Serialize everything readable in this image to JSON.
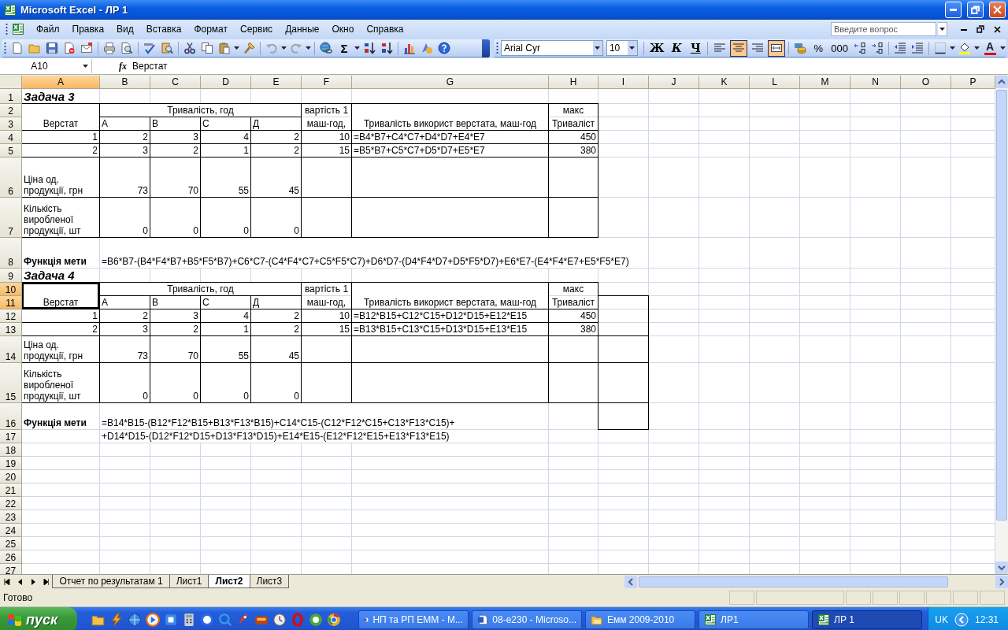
{
  "window": {
    "title": "Microsoft Excel - ЛР 1"
  },
  "menu": [
    "Файл",
    "Правка",
    "Вид",
    "Вставка",
    "Формат",
    "Сервис",
    "Данные",
    "Окно",
    "Справка"
  ],
  "help_search": {
    "placeholder": "Введите вопрос"
  },
  "standard_toolbar": {
    "autosum": "Σ"
  },
  "formatting_toolbar": {
    "font": "Arial Cyr",
    "size": "10",
    "style_buttons": [
      {
        "label": "Ж",
        "selected": false
      },
      {
        "label": "К",
        "selected": false
      },
      {
        "label": "Ч",
        "selected": false
      }
    ],
    "align_buttons": [
      {
        "kind": "left",
        "selected": false
      },
      {
        "kind": "center",
        "selected": true
      },
      {
        "kind": "right",
        "selected": false
      },
      {
        "kind": "merge",
        "selected": true
      }
    ],
    "number_buttons": [
      {
        "kind": "currency"
      },
      {
        "kind": "text",
        "label": "%"
      },
      {
        "kind": "text",
        "label": "000"
      },
      {
        "kind": "increase-decimal"
      },
      {
        "kind": "decrease-decimal"
      }
    ],
    "font_color_label": "A"
  },
  "formula_bar": {
    "name_box": "A10",
    "function_label": "fx",
    "value": "Верстат"
  },
  "columns": [
    {
      "label": "A",
      "selected": true
    },
    {
      "label": "B",
      "selected": false
    },
    {
      "label": "C",
      "selected": false
    },
    {
      "label": "D",
      "selected": false
    },
    {
      "label": "E",
      "selected": false
    },
    {
      "label": "F",
      "selected": false
    },
    {
      "label": "G",
      "selected": false
    },
    {
      "label": "H",
      "selected": false
    },
    {
      "label": "I",
      "selected": false
    },
    {
      "label": "J",
      "selected": false
    },
    {
      "label": "K",
      "selected": false
    },
    {
      "label": "L",
      "selected": false
    },
    {
      "label": "M",
      "selected": false
    },
    {
      "label": "N",
      "selected": false
    },
    {
      "label": "O",
      "selected": false
    },
    {
      "label": "P",
      "selected": false
    }
  ],
  "rows": [
    {
      "number": "1",
      "selected": false,
      "cells": [
        {
          "kind": "title",
          "text": "Задача 3",
          "selected": false
        }
      ]
    },
    {
      "number": "2",
      "selected": false,
      "cells": [
        {
          "kind": "heading",
          "text": "Верстат",
          "selected": false
        },
        {
          "kind": "heading",
          "text": "Тривалість, год",
          "selected": false
        },
        {
          "kind": "covered"
        },
        {
          "kind": "covered"
        },
        {
          "kind": "covered"
        },
        {
          "kind": "heading",
          "text": "вартість 1",
          "selected": false
        },
        {
          "kind": "heading",
          "text": "Тривалість використ верстата, маш-год",
          "selected": false
        },
        {
          "kind": "heading",
          "text": "макс",
          "selected": false
        }
      ]
    },
    {
      "number": "3",
      "selected": false,
      "cells": [
        {
          "kind": "covered_above"
        },
        {
          "kind": "label",
          "text": "А",
          "selected": false
        },
        {
          "kind": "label",
          "text": "В",
          "selected": false
        },
        {
          "kind": "label",
          "text": "С",
          "selected": false
        },
        {
          "kind": "label",
          "text": "Д",
          "selected": false
        },
        {
          "kind": "heading",
          "text": "маш-год,",
          "selected": false
        },
        {
          "kind": "covered_above"
        },
        {
          "kind": "heading",
          "text": "Тривалiст",
          "selected": false
        }
      ]
    },
    {
      "number": "4",
      "selected": false,
      "cells": [
        {
          "kind": "number",
          "text": "1",
          "selected": false
        },
        {
          "kind": "number",
          "text": "2",
          "selected": false
        },
        {
          "kind": "number",
          "text": "3",
          "selected": false
        },
        {
          "kind": "number",
          "text": "4",
          "selected": false
        },
        {
          "kind": "number",
          "text": "2",
          "selected": false
        },
        {
          "kind": "number",
          "text": "10",
          "selected": false
        },
        {
          "kind": "formula",
          "text": "=B4*B7+C4*C7+D4*D7+E4*E7",
          "selected": false
        },
        {
          "kind": "number",
          "text": "450",
          "selected": false
        }
      ]
    },
    {
      "number": "5",
      "selected": false,
      "cells": [
        {
          "kind": "number",
          "text": "2",
          "selected": false
        },
        {
          "kind": "number",
          "text": "3",
          "selected": false
        },
        {
          "kind": "number",
          "text": "2",
          "selected": false
        },
        {
          "kind": "number",
          "text": "1",
          "selected": false
        },
        {
          "kind": "number",
          "text": "2",
          "selected": false
        },
        {
          "kind": "number",
          "text": "15",
          "selected": false
        },
        {
          "kind": "formula",
          "text": "=B5*B7+C5*C7+D5*D7+E5*E7",
          "selected": false
        },
        {
          "kind": "number",
          "text": "380",
          "selected": false
        }
      ]
    },
    {
      "number": "6",
      "selected": false,
      "cells": [
        {
          "kind": "label",
          "text": "Ціна од. продукції, грн",
          "selected": false
        },
        {
          "kind": "number",
          "text": "73",
          "selected": false
        },
        {
          "kind": "number",
          "text": "70",
          "selected": false
        },
        {
          "kind": "number",
          "text": "55",
          "selected": false
        },
        {
          "kind": "number",
          "text": "45",
          "selected": false
        }
      ]
    },
    {
      "number": "7",
      "selected": false,
      "cells": [
        {
          "kind": "label",
          "text": "Кількість виробленої продукції, шт",
          "selected": false
        },
        {
          "kind": "number",
          "text": "0",
          "selected": false
        },
        {
          "kind": "number",
          "text": "0",
          "selected": false
        },
        {
          "kind": "number",
          "text": "0",
          "selected": false
        },
        {
          "kind": "number",
          "text": "0",
          "selected": false
        }
      ]
    },
    {
      "number": "8",
      "selected": false,
      "cells": [
        {
          "kind": "bold",
          "text": "Функція мети",
          "selected": false
        },
        {
          "kind": "formula",
          "text": "=B6*B7-(B4*F4*B7+B5*F5*B7)+C6*C7-(C4*F4*C7+C5*F5*C7)+D6*D7-(D4*F4*D7+D5*F5*D7)+E6*E7-(E4*F4*E7+E5*F5*E7)",
          "selected": false
        }
      ]
    },
    {
      "number": "9",
      "selected": false,
      "cells": [
        {
          "kind": "title",
          "text": "Задача 4",
          "selected": false
        }
      ]
    },
    {
      "number": "10",
      "selected": true,
      "cells": [
        {
          "kind": "heading",
          "text": "Верстат",
          "selected": true
        },
        {
          "kind": "heading",
          "text": "Тривалість, год",
          "selected": false
        },
        {
          "kind": "covered"
        },
        {
          "kind": "covered"
        },
        {
          "kind": "covered"
        },
        {
          "kind": "heading",
          "text": "вартість 1",
          "selected": false
        },
        {
          "kind": "heading",
          "text": "Тривалість використ верстата, маш-год",
          "selected": false
        },
        {
          "kind": "heading",
          "text": "макс",
          "selected": false
        }
      ]
    },
    {
      "number": "11",
      "selected": true,
      "cells": [
        {
          "kind": "covered_above"
        },
        {
          "kind": "label",
          "text": "А",
          "selected": false
        },
        {
          "kind": "label",
          "text": "В",
          "selected": false
        },
        {
          "kind": "label",
          "text": "С",
          "selected": false
        },
        {
          "kind": "label",
          "text": "Д",
          "selected": false
        },
        {
          "kind": "heading",
          "text": "маш-год,",
          "selected": false
        },
        {
          "kind": "covered_above"
        },
        {
          "kind": "heading",
          "text": "Тривалiст",
          "selected": false
        }
      ]
    },
    {
      "number": "12",
      "selected": false,
      "cells": [
        {
          "kind": "number",
          "text": "1",
          "selected": false
        },
        {
          "kind": "number",
          "text": "2",
          "selected": false
        },
        {
          "kind": "number",
          "text": "3",
          "selected": false
        },
        {
          "kind": "number",
          "text": "4",
          "selected": false
        },
        {
          "kind": "number",
          "text": "2",
          "selected": false
        },
        {
          "kind": "number",
          "text": "10",
          "selected": false
        },
        {
          "kind": "formula",
          "text": "=B12*B15+C12*C15+D12*D15+E12*E15",
          "selected": false
        },
        {
          "kind": "number",
          "text": "450",
          "selected": false
        }
      ]
    },
    {
      "number": "13",
      "selected": false,
      "cells": [
        {
          "kind": "number",
          "text": "2",
          "selected": false
        },
        {
          "kind": "number",
          "text": "3",
          "selected": false
        },
        {
          "kind": "number",
          "text": "2",
          "selected": false
        },
        {
          "kind": "number",
          "text": "1",
          "selected": false
        },
        {
          "kind": "number",
          "text": "2",
          "selected": false
        },
        {
          "kind": "number",
          "text": "15",
          "selected": false
        },
        {
          "kind": "formula",
          "text": "=B13*B15+C13*C15+D13*D15+E13*E15",
          "selected": false
        },
        {
          "kind": "number",
          "text": "380",
          "selected": false
        }
      ]
    },
    {
      "number": "14",
      "selected": false,
      "cells": [
        {
          "kind": "label",
          "text": "Ціна од. продукції, грн",
          "selected": false
        },
        {
          "kind": "number",
          "text": "73",
          "selected": false
        },
        {
          "kind": "number",
          "text": "70",
          "selected": false
        },
        {
          "kind": "number",
          "text": "55",
          "selected": false
        },
        {
          "kind": "number",
          "text": "45",
          "selected": false
        }
      ]
    },
    {
      "number": "15",
      "selected": false,
      "cells": [
        {
          "kind": "label",
          "text": "Кількість виробленої продукції, шт",
          "selected": false
        },
        {
          "kind": "number",
          "text": "0",
          "selected": false
        },
        {
          "kind": "number",
          "text": "0",
          "selected": false
        },
        {
          "kind": "number",
          "text": "0",
          "selected": false
        },
        {
          "kind": "number",
          "text": "0",
          "selected": false
        }
      ]
    },
    {
      "number": "16",
      "selected": false,
      "cells": [
        {
          "kind": "bold",
          "text": "Функція мети",
          "selected": false
        },
        {
          "kind": "formula",
          "text": "=B14*B15-(B12*F12*B15+B13*F13*B15)+C14*C15-(C12*F12*C15+C13*F13*C15)+",
          "selected": false
        }
      ]
    },
    {
      "number": "17",
      "selected": false,
      "cells": [
        {
          "kind": "empty"
        },
        {
          "kind": "formula",
          "text": "+D14*D15-(D12*F12*D15+D13*F13*D15)+E14*E15-(E12*F12*E15+E13*F13*E15)",
          "selected": false
        }
      ]
    },
    {
      "number": "18",
      "selected": false
    },
    {
      "number": "19",
      "selected": false
    },
    {
      "number": "20",
      "selected": false
    },
    {
      "number": "21",
      "selected": false
    },
    {
      "number": "22",
      "selected": false
    },
    {
      "number": "23",
      "selected": false
    },
    {
      "number": "24",
      "selected": false
    },
    {
      "number": "25",
      "selected": false
    },
    {
      "number": "26",
      "selected": false
    },
    {
      "number": "27",
      "selected": false
    }
  ],
  "sheet_tabs": [
    {
      "label": "Отчет по результатам 1",
      "selected": false
    },
    {
      "label": "Лист1",
      "selected": false
    },
    {
      "label": "Лист2",
      "selected": true
    },
    {
      "label": "Лист3",
      "selected": false
    }
  ],
  "status_bar": {
    "text": "Готово"
  },
  "taskbar": {
    "start": "пуск",
    "tasks": [
      {
        "label": "НП та РП ЕММ - М...",
        "kind": "word",
        "selected": false
      },
      {
        "label": "08-e230 - Microso...",
        "kind": "word",
        "selected": false
      },
      {
        "label": "Емм 2009-2010",
        "kind": "folder",
        "selected": false
      },
      {
        "label": "ЛР1",
        "kind": "excel",
        "selected": false
      },
      {
        "label": "ЛР 1",
        "kind": "excel",
        "selected": true
      }
    ],
    "language": "UK",
    "time": "12:31"
  }
}
